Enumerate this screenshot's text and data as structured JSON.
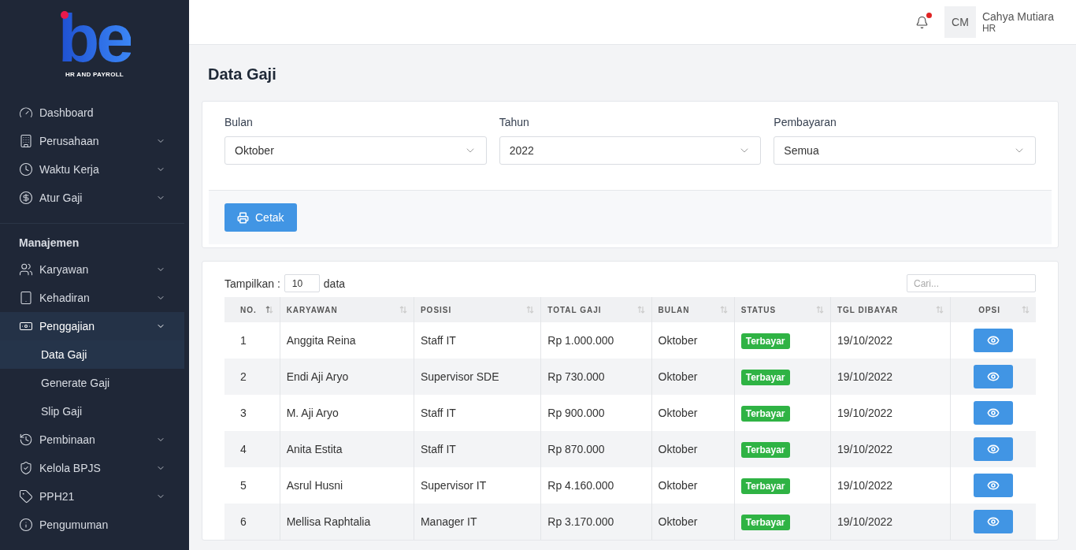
{
  "logo": {
    "mark": "be",
    "tagline": "HR AND PAYROLL"
  },
  "sidebar": {
    "groups": [
      {
        "items": [
          {
            "label": "Dashboard",
            "selected": false
          },
          {
            "label": "Perusahaan",
            "has_children": true,
            "selected": false
          },
          {
            "label": "Waktu Kerja",
            "has_children": true,
            "selected": false
          },
          {
            "label": "Atur Gaji",
            "has_children": true,
            "selected": false
          }
        ]
      },
      {
        "heading": "Manajemen",
        "items": [
          {
            "label": "Karyawan",
            "has_children": true,
            "selected": false
          },
          {
            "label": "Kehadiran",
            "has_children": true,
            "selected": false
          },
          {
            "label": "Penggajian",
            "has_children": true,
            "expanded": true,
            "selected": true,
            "children": [
              {
                "label": "Data Gaji",
                "selected": true
              },
              {
                "label": "Generate Gaji",
                "selected": false
              },
              {
                "label": "Slip Gaji",
                "selected": false
              }
            ]
          },
          {
            "label": "Pembinaan",
            "has_children": true,
            "selected": false
          },
          {
            "label": "Kelola BPJS",
            "has_children": true,
            "selected": false
          },
          {
            "label": "PPH21",
            "has_children": true,
            "selected": false
          },
          {
            "label": "Pengumuman",
            "selected": false
          }
        ]
      }
    ]
  },
  "header": {
    "notification_unread": true,
    "user": {
      "initials": "CM",
      "name": "Cahya Mutiara",
      "role": "HR"
    }
  },
  "page_title": "Data Gaji",
  "filters": [
    {
      "label": "Bulan",
      "value": "Oktober"
    },
    {
      "label": "Tahun",
      "value": "2022"
    },
    {
      "label": "Pembayaran",
      "value": "Semua"
    }
  ],
  "print_button": "Cetak",
  "table": {
    "show_label": "Tampilkan :",
    "page_size": "10",
    "show_suffix": "data",
    "search": {
      "placeholder": "Cari..."
    },
    "columns": [
      {
        "label": "NO.",
        "sorted": true
      },
      {
        "label": "KARYAWAN",
        "sorted": false
      },
      {
        "label": "POSISI",
        "sorted": false
      },
      {
        "label": "TOTAL GAJI",
        "sorted": false
      },
      {
        "label": "BULAN",
        "sorted": false
      },
      {
        "label": "STATUS",
        "sorted": false
      },
      {
        "label": "TGL DIBAYAR",
        "sorted": false
      },
      {
        "label": "OPSI",
        "sorted": false
      }
    ],
    "rows": [
      {
        "no": "1",
        "name": "Anggita Reina",
        "position": "Staff IT",
        "total": "Rp 1.000.000",
        "month": "Oktober",
        "status": "Terbayar",
        "paid": true,
        "date": "19/10/2022"
      },
      {
        "no": "2",
        "name": "Endi Aji Aryo",
        "position": "Supervisor SDE",
        "total": "Rp 730.000",
        "month": "Oktober",
        "status": "Terbayar",
        "paid": true,
        "date": "19/10/2022"
      },
      {
        "no": "3",
        "name": "M. Aji Aryo",
        "position": "Staff IT",
        "total": "Rp 900.000",
        "month": "Oktober",
        "status": "Terbayar",
        "paid": true,
        "date": "19/10/2022"
      },
      {
        "no": "4",
        "name": "Anita Estita",
        "position": "Staff IT",
        "total": "Rp 870.000",
        "month": "Oktober",
        "status": "Terbayar",
        "paid": true,
        "date": "19/10/2022"
      },
      {
        "no": "5",
        "name": "Asrul Husni",
        "position": "Supervisor IT",
        "total": "Rp 4.160.000",
        "month": "Oktober",
        "status": "Terbayar",
        "paid": true,
        "date": "19/10/2022"
      },
      {
        "no": "6",
        "name": "Mellisa Raphtalia",
        "position": "Manager IT",
        "total": "Rp 3.170.000",
        "month": "Oktober",
        "status": "Terbayar",
        "paid": true,
        "date": "19/10/2022"
      }
    ]
  }
}
